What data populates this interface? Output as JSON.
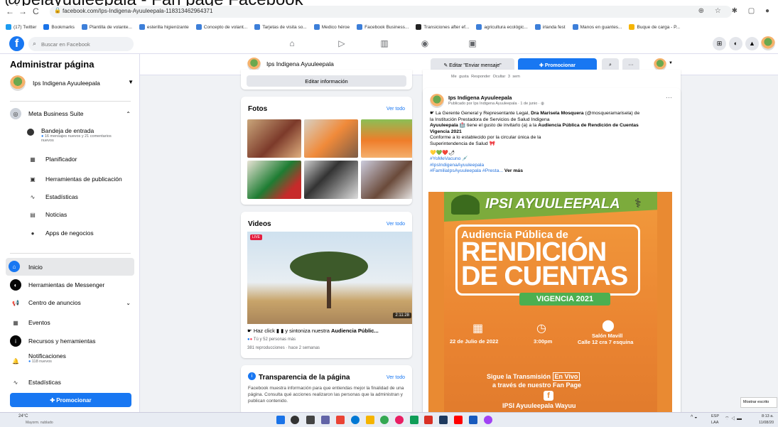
{
  "window_title": "@pelayuuleepala - Fan page Facebook",
  "browser": {
    "url": "facebook.com/Ips-Indigena-Ayuuleepala-118313462964371",
    "bookmarks": [
      {
        "label": "(17) Twitter",
        "color": "#1d9bf0"
      },
      {
        "label": "Bookmarks",
        "color": "#1a73e8"
      },
      {
        "label": "Plantilla de volante...",
        "color": "#3d7fd9"
      },
      {
        "label": "esterilla higienizante",
        "color": "#3d7fd9"
      },
      {
        "label": "Concepto de volant...",
        "color": "#3d7fd9"
      },
      {
        "label": "Tarjetas de visita so...",
        "color": "#3d7fd9"
      },
      {
        "label": "Medico héroe",
        "color": "#3d7fd9"
      },
      {
        "label": "Facebook Business...",
        "color": "#3d7fd9"
      },
      {
        "label": "Transiciones after ef...",
        "color": "#222"
      },
      {
        "label": "agricultura ecológic...",
        "color": "#3d7fd9"
      },
      {
        "label": "irlanda fest",
        "color": "#3d7fd9"
      },
      {
        "label": "Manos en guantes...",
        "color": "#3d7fd9"
      },
      {
        "label": "Buque de carga - P...",
        "color": "#f5b400"
      }
    ]
  },
  "fb": {
    "search_placeholder": "Buscar en Facebook",
    "brand_color": "#1877f2"
  },
  "sidebar": {
    "title": "Administrar página",
    "page_name": "Ips Indigena Ayuuleepala",
    "meta_suite": "Meta Business Suite",
    "inbox_label": "Bandeja de entrada",
    "inbox_sub": "16 mensajes nuevos y 21 comentarios nuevos",
    "items_suite": [
      {
        "label": "Planificador",
        "icon": "calendar-icon"
      },
      {
        "label": "Herramientas de publicación",
        "icon": "publishing-icon"
      },
      {
        "label": "Estadísticas",
        "icon": "insights-icon"
      },
      {
        "label": "Noticias",
        "icon": "news-icon"
      },
      {
        "label": "Apps de negocios",
        "icon": "apps-icon"
      }
    ],
    "inicio": "Inicio",
    "messenger": "Herramientas de Messenger",
    "ads_center": "Centro de anuncios",
    "events": "Eventos",
    "resources": "Recursos y herramientas",
    "notifications": "Notificaciones",
    "notifications_sub": "118 nuevos",
    "stats": "Estadísticas",
    "promote": "Promocionar"
  },
  "pagebar": {
    "page_name": "Ips Indigena Ayuuleepala",
    "edit_button": "Editar \"Enviar mensaje\"",
    "promote_button": "Promocionar",
    "more": "···"
  },
  "left_col": {
    "edit_info": "Editar información",
    "photos_title": "Fotos",
    "see_all": "Ver todo",
    "videos_title": "Videos",
    "live_badge": "LIVE",
    "video_duration": "2:11:28",
    "video_caption_prefix": "Haz click",
    "video_caption_mid": "y sintoniza nuestra",
    "video_caption_bold": "Audiencia Públic...",
    "video_reactions": "Tú y 52 personas más",
    "video_meta": "381 reproducciones · hace 2 semanas",
    "transparency_title": "Transparencia de la página",
    "transparency_text": "Facebook muestra información para que entiendas mejor la finalidad de una página. Consulta qué acciones realizaron las personas que la administran y publican contenido."
  },
  "post": {
    "prev_actions": "Me gusta  Responder  Ocultar  3 sem",
    "author": "Ips Indigena Ayuuleepala",
    "meta": "Publicado por Ips Indigena Ayuuleepala · 1 de junio ·",
    "line1a": "La Gerente General y Representante Legal,",
    "line1b": "Dra Marisela Mosquera",
    "line1c": "(@mosqueramarisela) de",
    "line2": "la Institución Prestadora de Servicios de Salud Indigena",
    "line3a": "Ayuuleepala",
    "line3b": "tiene el gusto de invitarlo (a) a la",
    "line3c": "Audiencia Pública de Rendición de Cuentas",
    "line4": "Vigencia 2021",
    "line5": "Conforme a lo establecido por la circular única de la",
    "line6": "Superintendencia de Salud",
    "hashtags1": "#YoMeVacuno",
    "hashtags2": "#IpsIndigenaAyuuleepala",
    "hashtags3": "#FamiliaIpsAyuuleepala #Presta...",
    "see_more": "Ver más",
    "more": "···"
  },
  "poster": {
    "brand": "IPSI AYUULEEPALA",
    "audiencia": "Audiencia Pública de",
    "rendicion": "RENDICIÓN",
    "de_cuentas": "DE CUENTAS",
    "vigencia": "VIGENCIA 2021",
    "date": "22 de Julio de 2022",
    "time": "3:00pm",
    "place1": "Salón Mavill",
    "place2": "Calle 12 cra 7 esquina",
    "stream1": "Sigue la Transmisión",
    "stream_live": "En Vivo",
    "stream2": "a través de nuestro Fan Page",
    "footer": "IPSI Ayuuleepala Wayuu",
    "bg_color": "#e98a32",
    "green_color": "#4caf50"
  },
  "taskbar": {
    "weather_temp": "24°C",
    "weather_desc": "Mayorm. nublado",
    "lang1": "ESP",
    "lang2": "LAA",
    "time": "8:13 a.",
    "date": "11/08/20",
    "tooltip": "Mostrar escrito"
  }
}
